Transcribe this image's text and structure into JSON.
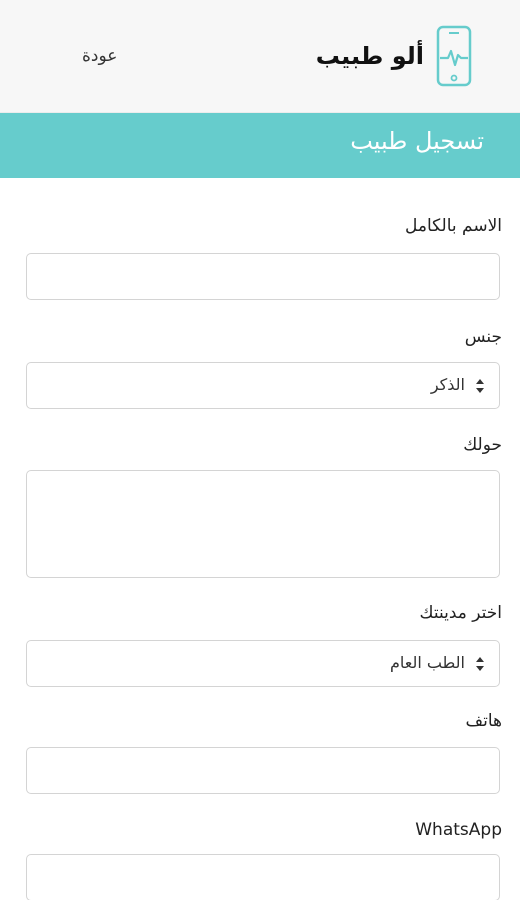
{
  "header": {
    "brand_name": "ألو طبيب",
    "back_label": "عودة",
    "logo_icon": "phone-heartbeat-icon",
    "logo_color": "#66cccc"
  },
  "title_bar": {
    "title": "تسجيل طبيب",
    "color": "#66cccc"
  },
  "form": {
    "full_name": {
      "label": "الاسم بالكامل",
      "value": ""
    },
    "gender": {
      "label": "جنس",
      "selected": "الذكر"
    },
    "about": {
      "label": "حولك",
      "value": ""
    },
    "city": {
      "label": "اختر مدينتك",
      "selected": "الطب العام"
    },
    "phone": {
      "label": "هاتف",
      "value": ""
    },
    "whatsapp": {
      "label": "WhatsApp",
      "value": ""
    }
  }
}
